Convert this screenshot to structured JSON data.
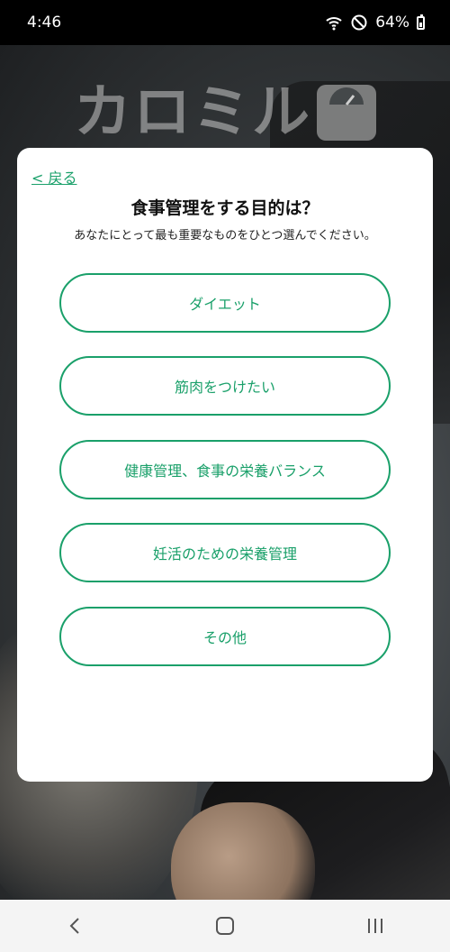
{
  "status_bar": {
    "time": "4:46",
    "battery_percent": "64%",
    "icons": [
      "wifi-icon",
      "do-not-disturb-icon",
      "battery-icon"
    ]
  },
  "background": {
    "logo_text": "カロミル",
    "logo_icon": "scale-icon"
  },
  "modal": {
    "back_label": "< 戻る",
    "title": "食事管理をする目的は？",
    "subtitle": "あなたにとって最も重要なものをひとつ選んでください。",
    "options": [
      {
        "label": "ダイエット"
      },
      {
        "label": "筋肉をつけたい"
      },
      {
        "label": "健康管理、食事の栄養バランス"
      },
      {
        "label": "妊活のための栄養管理"
      },
      {
        "label": "その他"
      }
    ]
  },
  "nav_bar": {
    "buttons": [
      "back-icon",
      "home-icon",
      "recents-icon"
    ]
  },
  "colors": {
    "accent": "#1aa06a",
    "modal_bg": "#ffffff",
    "status_bar_bg": "#000000",
    "nav_bar_bg": "#f4f4f4"
  }
}
